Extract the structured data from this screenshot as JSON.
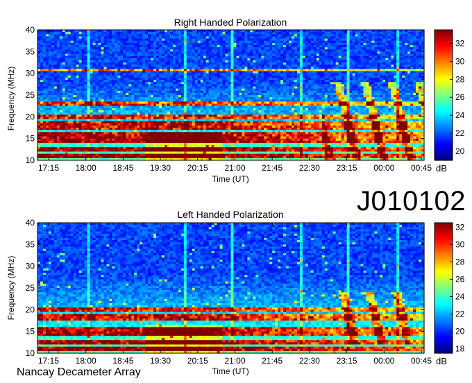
{
  "observation_id": "J010102",
  "observatory": "Nancay Decameter Array",
  "chart_data": [
    {
      "type": "heatmap",
      "title": "Right Handed Polarization",
      "xlabel": "Time (UT)",
      "ylabel": "Frequency (MHz)",
      "x_ticks": [
        "17:15",
        "18:00",
        "18:45",
        "19:30",
        "20:15",
        "21:00",
        "21:45",
        "22:30",
        "23:15",
        "00:00",
        "00:45"
      ],
      "y_ticks": [
        10,
        15,
        20,
        25,
        30,
        35,
        40
      ],
      "ylim": [
        10,
        40
      ],
      "colorbar": {
        "label": "dB",
        "ticks": [
          20,
          22,
          24,
          26,
          28,
          30,
          32
        ],
        "range": [
          19,
          33.5
        ]
      },
      "intense_bands_mhz": [
        [
          10.5,
          11.5
        ],
        [
          12,
          13
        ],
        [
          14,
          16.5
        ],
        [
          17,
          19
        ],
        [
          19.5,
          20.5
        ],
        [
          22.5,
          23.5
        ],
        [
          30.5,
          31
        ]
      ],
      "burst_region": {
        "time_range": [
          "22:45",
          "00:45"
        ],
        "freq_range_mhz": [
          10,
          28
        ]
      },
      "colors": {
        "low": "#00008f",
        "mid": "#00ffff",
        "high": "#ff0000",
        "top": "#800000"
      }
    },
    {
      "type": "heatmap",
      "title": "Left Handed Polarization",
      "xlabel": "Time (UT)",
      "ylabel": "Frequency (MHz)",
      "x_ticks": [
        "17:15",
        "18:00",
        "18:45",
        "19:30",
        "20:15",
        "21:00",
        "21:45",
        "22:30",
        "23:15",
        "00:00",
        "00:45"
      ],
      "y_ticks": [
        10,
        15,
        20,
        25,
        30,
        35,
        40
      ],
      "ylim": [
        10,
        40
      ],
      "colorbar": {
        "label": "dB",
        "ticks": [
          18,
          20,
          22,
          24,
          26,
          28,
          30,
          32
        ],
        "range": [
          17.5,
          32.5
        ]
      },
      "intense_bands_mhz": [
        [
          10.5,
          11.5
        ],
        [
          12,
          13
        ],
        [
          14,
          16
        ],
        [
          17.5,
          19
        ],
        [
          19.5,
          20.5
        ]
      ],
      "burst_region": {
        "time_range": [
          "23:00",
          "00:30"
        ],
        "freq_range_mhz": [
          12,
          24
        ]
      },
      "colors": {
        "low": "#00008f",
        "mid": "#00ffff",
        "high": "#ff0000",
        "top": "#800000"
      }
    }
  ]
}
